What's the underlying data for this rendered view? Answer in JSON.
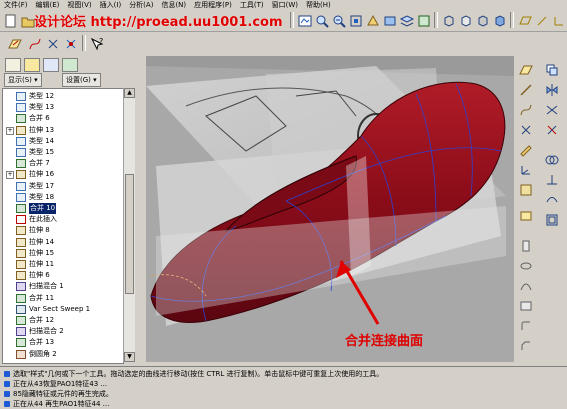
{
  "menu": {
    "items": [
      "文件(F)",
      "编辑(E)",
      "视图(V)",
      "插入(I)",
      "分析(A)",
      "信息(N)",
      "应用程序(P)",
      "工具(T)",
      "窗口(W)",
      "帮助(H)"
    ]
  },
  "watermark": "设计论坛 http://proead.uu1001.com",
  "tree_header": {
    "show_label": "显示(S)",
    "settings_label": "设置(G)"
  },
  "tree": {
    "items": [
      {
        "label": "类型 12",
        "icon": "style-feature-icon"
      },
      {
        "label": "类型 13",
        "icon": "style-feature-icon"
      },
      {
        "label": "合并 6",
        "icon": "merge-icon"
      },
      {
        "label": "拉伸 13",
        "icon": "extrude-icon",
        "expander": "+"
      },
      {
        "label": "类型 14",
        "icon": "style-feature-icon"
      },
      {
        "label": "类型 15",
        "icon": "style-feature-icon"
      },
      {
        "label": "合并 7",
        "icon": "merge-icon"
      },
      {
        "label": "拉伸 16",
        "icon": "extrude-icon",
        "expander": "+"
      },
      {
        "label": "类型 17",
        "icon": "style-feature-icon"
      },
      {
        "label": "类型 18",
        "icon": "style-feature-icon"
      },
      {
        "label": "合并 10",
        "icon": "merge-icon",
        "selected": true
      },
      {
        "label": "在此插入",
        "icon": "insert-arrow-icon"
      },
      {
        "label": "拉伸 8",
        "icon": "extrude-icon"
      },
      {
        "label": "拉伸 14",
        "icon": "extrude-icon"
      },
      {
        "label": "拉伸 15",
        "icon": "extrude-icon"
      },
      {
        "label": "拉伸 11",
        "icon": "extrude-icon"
      },
      {
        "label": "拉伸 6",
        "icon": "extrude-icon"
      },
      {
        "label": "扫描混合 1",
        "icon": "sweep-blend-icon"
      },
      {
        "label": "合并 11",
        "icon": "merge-icon"
      },
      {
        "label": "Var Sect Sweep 1",
        "icon": "var-sect-sweep-icon"
      },
      {
        "label": "合并 12",
        "icon": "merge-icon"
      },
      {
        "label": "扫描混合 2",
        "icon": "sweep-blend-icon"
      },
      {
        "label": "合并 13",
        "icon": "merge-icon"
      },
      {
        "label": "倒圆角 2",
        "icon": "round-icon"
      }
    ]
  },
  "annotation": "合并连接曲面",
  "messages": [
    "选取\"样式\"几何或下一个工具。拖动选定的曲线进行移动(按住 CTRL 进行复制)。单击鼠标中键可重复上次使用的工具。",
    "正在从43恢复PAO1特征43 ...",
    "85隐藏特征或元件的再生完成。",
    "正在从44 再生PAO1特征44 ..."
  ],
  "colors": {
    "body_red": "#8e0d1a",
    "selection": "#0a246a",
    "annotation_red": "#e00000",
    "ui_gray": "#d4d0c8"
  }
}
